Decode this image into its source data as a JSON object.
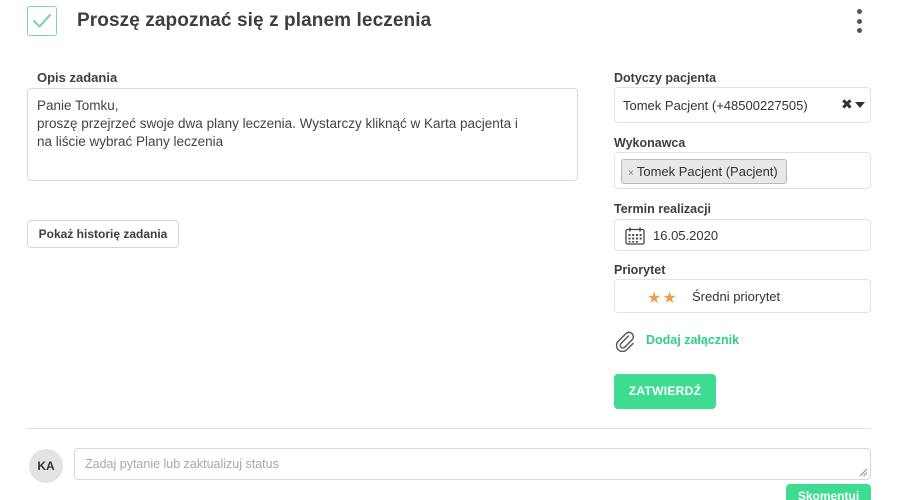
{
  "task": {
    "title": "Proszę zapoznać się z planem leczenia",
    "description_label": "Opis zadania",
    "description_lines": [
      "Panie Tomku,",
      "proszę przejrzeć swoje dwa plany leczenia. Wystarczy kliknąć w Karta pacjenta i",
      "na liście wybrać Plany leczenia"
    ],
    "history_button": "Pokaż historię zadania"
  },
  "sidebar": {
    "patient_label": "Dotyczy pacjenta",
    "patient_value": "Tomek Pacjent (+48500227505)",
    "executor_label": "Wykonawca",
    "executor_tag": "Tomek Pacjent (Pacjent)",
    "due_label": "Termin realizacji",
    "due_value": "16.05.2020",
    "priority_label": "Priorytet",
    "priority_value": "Średni priorytet",
    "priority_stars": 2,
    "attachment_link": "Dodaj załącznik",
    "confirm_button": "ZATWIERDŹ"
  },
  "comments": {
    "avatar_initials": "KA",
    "input_placeholder": "Zadaj pytanie lub zaktualizuj status",
    "submit_button": "Skomentuj"
  },
  "colors": {
    "accent_green": "#3ddc91",
    "star_orange": "#f0a04b"
  },
  "icons": [
    "check-icon",
    "kebab-menu-icon",
    "clear-icon",
    "chevron-down-icon",
    "calendar-icon",
    "star-icon",
    "paperclip-icon",
    "resize-grip-icon"
  ]
}
